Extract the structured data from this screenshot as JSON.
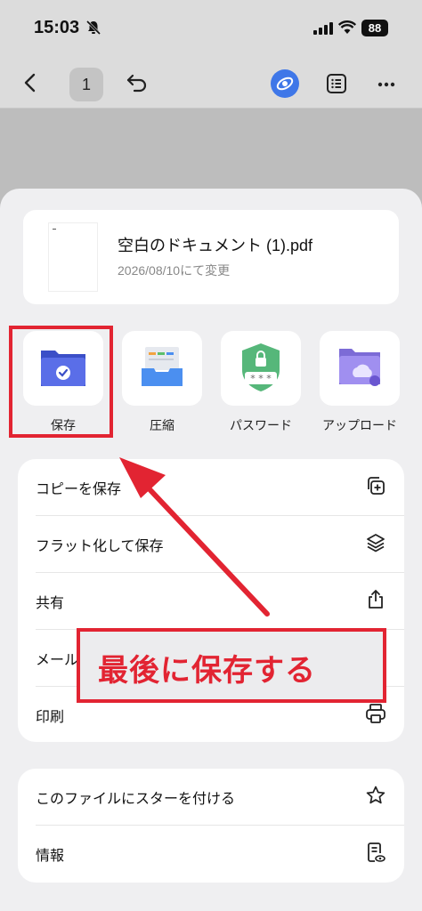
{
  "status": {
    "time": "15:03",
    "battery": "88"
  },
  "toolbar": {
    "page_number": "1"
  },
  "file": {
    "name": "空白のドキュメント (1).pdf",
    "date": "2026/08/10にて変更"
  },
  "actions": [
    {
      "label": "保存",
      "icon": "folder-check-icon"
    },
    {
      "label": "圧縮",
      "icon": "archive-drawer-icon"
    },
    {
      "label": "パスワード",
      "icon": "shield-lock-icon"
    },
    {
      "label": "アップロード",
      "icon": "cloud-folder-icon"
    }
  ],
  "menu1": [
    {
      "label": "コピーを保存",
      "icon": "copy-plus-icon"
    },
    {
      "label": "フラット化して保存",
      "icon": "layers-icon"
    },
    {
      "label": "共有",
      "icon": "share-icon"
    },
    {
      "label": "メール",
      "icon": "mail-icon"
    },
    {
      "label": "印刷",
      "icon": "printer-icon"
    }
  ],
  "menu2": [
    {
      "label": "このファイルにスターを付ける",
      "icon": "star-icon"
    },
    {
      "label": "情報",
      "icon": "info-document-icon"
    }
  ],
  "annotation": {
    "callout_text": "最後に保存する",
    "color": "#e22432"
  }
}
